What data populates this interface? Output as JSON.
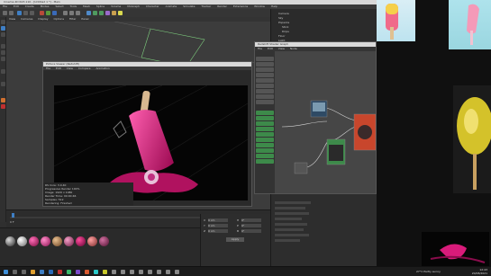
{
  "c4d": {
    "title": "Cinema 4D R23.110 - [Untitled 1 *] - Main",
    "menu": [
      "File",
      "Edit",
      "Create",
      "Modes",
      "Select",
      "Tools",
      "Mesh",
      "Spline",
      "Volume",
      "MoGraph",
      "Character",
      "Animate",
      "Simulate",
      "Tracker",
      "Render",
      "Extensions",
      "Window",
      "Help"
    ],
    "viewport_menu": [
      "View",
      "Cameras",
      "Display",
      "Options",
      "Filter",
      "Panel"
    ]
  },
  "object_manager": {
    "rows": [
      "Camera",
      "Sky",
      "Popsicle",
      "Stick",
      "Drips",
      "Floor",
      "Light"
    ]
  },
  "picture_viewer": {
    "title": "Picture Viewer (Redshift)",
    "menu": [
      "File",
      "Edit",
      "View",
      "Compare",
      "Animation"
    ],
    "info": [
      "RS Core: 3.0.40",
      "Progressive Render 100%",
      "Image: 1920 x 1080",
      "Render Time: 00:00:46",
      "Samples: 512",
      "Rendering: Finished"
    ]
  },
  "node_editor": {
    "title": "Redshift Shader Graph",
    "menu": [
      "File",
      "Edit",
      "View",
      "Node"
    ]
  },
  "attributes": {
    "header": "RS Material",
    "rows": [
      "Basic",
      "Reflection",
      "Refraction",
      "Subsurface",
      "Coating",
      "Emission",
      "Overall"
    ]
  },
  "timeline": {
    "start": "0 F",
    "end": "90 F"
  },
  "coords": {
    "labels": [
      "X",
      "Y",
      "Z",
      "H",
      "P",
      "B"
    ],
    "values": [
      "0 cm",
      "0 cm",
      "0 cm",
      "0°",
      "0°",
      "0°"
    ],
    "apply": "Apply"
  },
  "taskbar": {
    "weather": "27°C Partly sunny",
    "time": "12:43",
    "date": "20/08/2021"
  },
  "colors": {
    "accent_pink": "#d81b7a",
    "node_orange": "#c8462c",
    "node_green": "#3d8a4a"
  }
}
